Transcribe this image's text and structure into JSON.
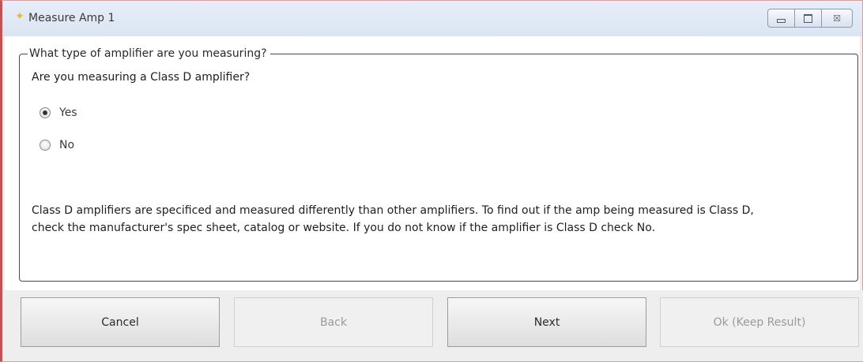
{
  "window": {
    "title": "Measure Amp 1",
    "title_icon": "app-spark-icon",
    "controls": {
      "minimize_icon": "minimize-icon",
      "maximize_icon": "maximize-icon",
      "close_icon": "close-icon",
      "close_glyph": "☒"
    }
  },
  "group": {
    "legend": "What type of amplifier are you measuring?",
    "question": "Are you measuring a Class D amplifier?",
    "options": [
      {
        "label": "Yes",
        "selected": true
      },
      {
        "label": "No",
        "selected": false
      }
    ],
    "info_line1": "Class D amplifiers are specificed and measured differently than other amplifiers.  To find out if the amp being measured is Class D,",
    "info_line2": "check the manufacturer's spec sheet, catalog or website.  If you do not know if the amplifier is Class D check No."
  },
  "buttons": {
    "cancel": {
      "label": "Cancel",
      "enabled": true
    },
    "back": {
      "label": "Back",
      "enabled": false
    },
    "next": {
      "label": "Next",
      "enabled": true
    },
    "ok": {
      "label": "Ok (Keep Result)",
      "enabled": false
    }
  },
  "colors": {
    "accent_border": "#c95050",
    "title_icon": "#f0b822",
    "disabled_text": "#9a9a9a"
  }
}
